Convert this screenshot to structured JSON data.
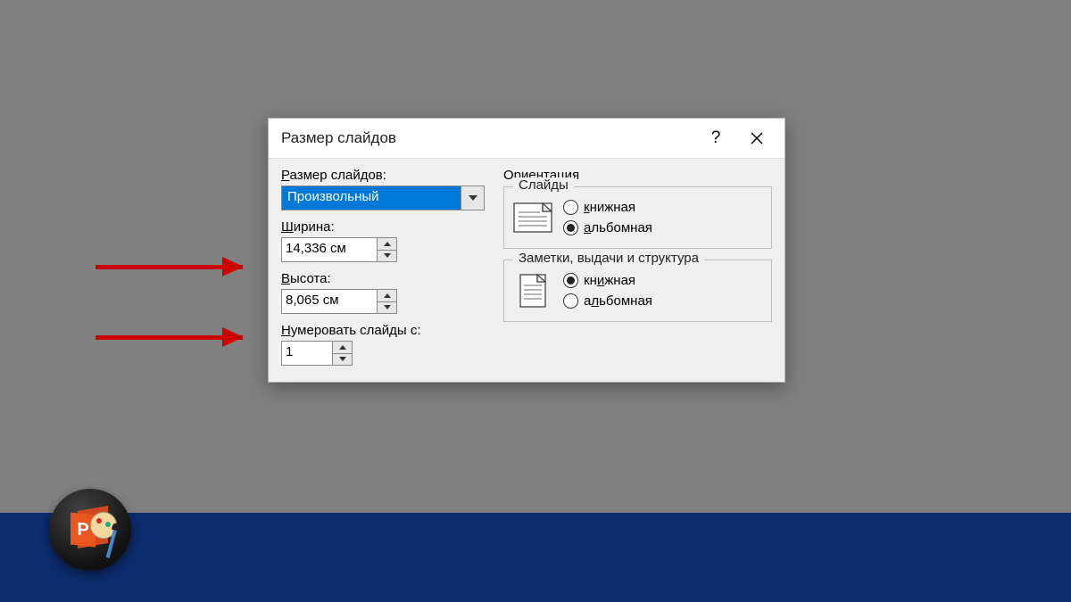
{
  "dialog": {
    "title": "Размер слайдов",
    "size_label": "Размер слайдов:",
    "size_value": "Произвольный",
    "width_label": "Ширина:",
    "width_value": "14,336 см",
    "height_label": "Высота:",
    "height_value": "8,065 см",
    "number_from_label": "Нумеровать слайды с:",
    "number_from_value": "1",
    "orientation_legend": "Ориентация",
    "slides_group": {
      "legend": "Слайды",
      "portrait_label": "книжная",
      "landscape_label": "альбомная",
      "selected": "landscape"
    },
    "notes_group": {
      "legend": "Заметки, выдачи и структура",
      "portrait_label": "книжная",
      "landscape_label": "альбомная",
      "selected": "portrait"
    }
  },
  "logo_letter": "P"
}
